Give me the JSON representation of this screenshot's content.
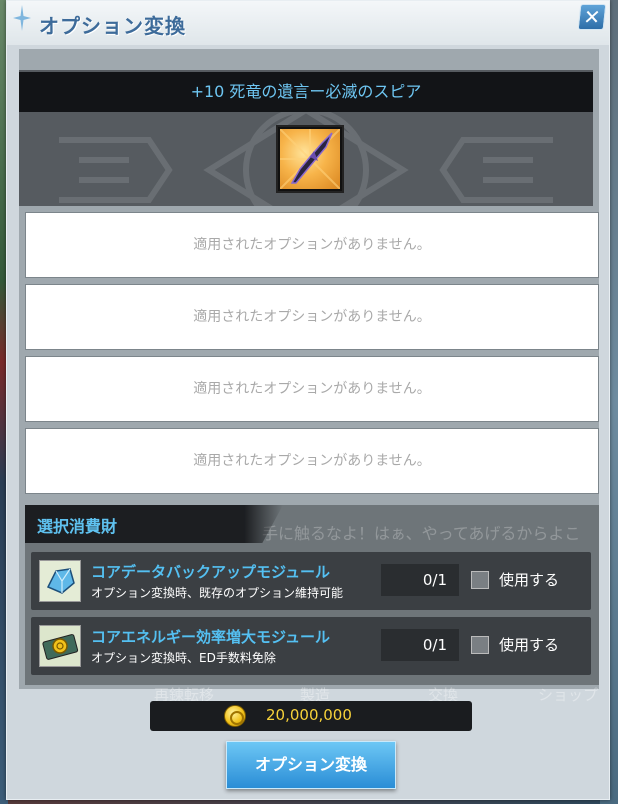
{
  "window": {
    "title": "オプション変換"
  },
  "item": {
    "name": "+10 死竜の遺言ー必滅のスピア",
    "icon": "spear-icon"
  },
  "options": [
    {
      "text": "適用されたオプションがありません。"
    },
    {
      "text": "適用されたオプションがありません。"
    },
    {
      "text": "適用されたオプションがありません。"
    },
    {
      "text": "適用されたオプションがありません。"
    }
  ],
  "consumables": {
    "header": "選択消費財",
    "items": [
      {
        "title": "コアデータバックアップモジュール",
        "desc": "オプション変換時、既存のオプション維持可能",
        "count": "0/1",
        "checkbox_label": "使用する",
        "icon": "crystal-module-icon"
      },
      {
        "title": "コアエネルギー効率増大モジュール",
        "desc": "オプション変換時、ED手数料免除",
        "count": "0/1",
        "checkbox_label": "使用する",
        "icon": "coin-ticket-icon"
      }
    ]
  },
  "background": {
    "faded_text": "手に触るなよ！はぁ、やってあげるからよこ",
    "faded_tabs": [
      "再錬転移",
      "製造",
      "交換",
      "ショップ"
    ]
  },
  "cost": {
    "value": "20,000,000",
    "icon": "ed-coin-icon"
  },
  "actions": {
    "exchange_label": "オプション変換"
  },
  "colors": {
    "accent": "#5fc2f0",
    "title": "#3d6b9a",
    "cost": "#f7d23a",
    "button": "#2a8dd6"
  }
}
